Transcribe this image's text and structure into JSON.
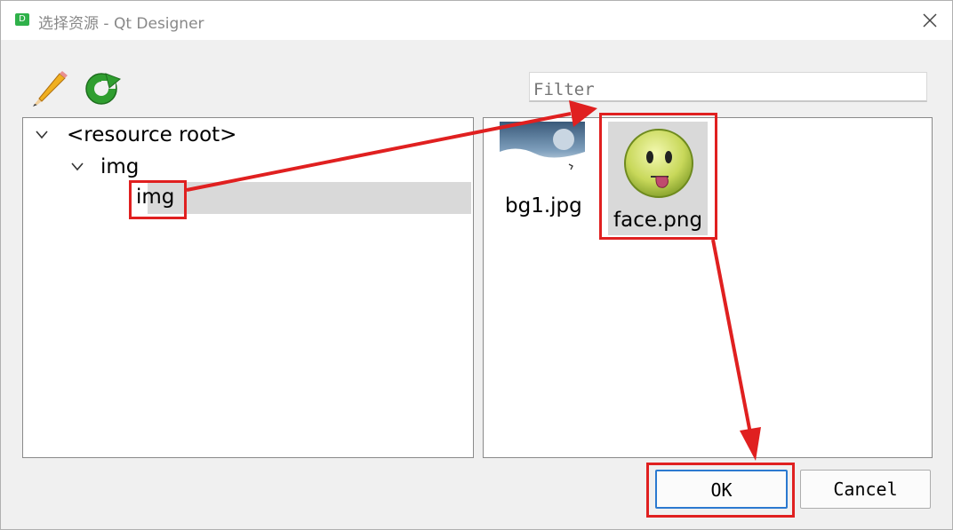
{
  "window": {
    "title": "选择资源 - Qt Designer",
    "app_icon_letter": "D"
  },
  "toolbar": {
    "edit_icon": "pencil-icon",
    "reload_icon": "reload-icon"
  },
  "filter": {
    "placeholder": "Filter",
    "value": ""
  },
  "tree": {
    "items": [
      {
        "label": "<resource root>",
        "expanded": true
      },
      {
        "label": "img",
        "expanded": true
      },
      {
        "label": "img",
        "selected": true
      }
    ]
  },
  "files": [
    {
      "name": "bg1.jpg"
    },
    {
      "name": "face.png",
      "selected": true
    }
  ],
  "buttons": {
    "ok": "OK",
    "cancel": "Cancel"
  },
  "colors": {
    "annotation_red": "#e02020",
    "selection_gray": "#d9d9d9",
    "focus_blue": "#2b79d0"
  }
}
